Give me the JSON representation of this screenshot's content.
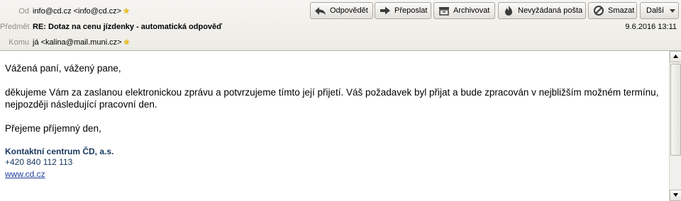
{
  "header": {
    "from_label": "Od",
    "from_value": "info@cd.cz <info@cd.cz>",
    "subject_label": "Předmět",
    "subject_value": "RE: Dotaz na cenu jízdenky - automatická odpověď",
    "to_label": "Komu",
    "to_value": "já <kalina@mail.muni.cz>",
    "date": "9.6.2016 13:11"
  },
  "toolbar": {
    "reply_label": "Odpovědět",
    "forward_label": "Přeposlat",
    "archive_label": "Archivovat",
    "junk_label": "Nevyžádaná pošta",
    "delete_label": "Smazat",
    "more_label": "Další"
  },
  "body": {
    "greeting": "Vážená paní, vážený pane,",
    "paragraph1": "děkujeme Vám za zaslanou elektronickou zprávu a potvrzujeme tímto její přijetí. Váš požadavek byl přijat a bude zpracován v nejbližším možném termínu, nejpozději následující pracovní den.",
    "closing": "Přejeme příjemný den,",
    "signature_name": "Kontaktní centrum ČD, a.s.",
    "signature_phone": "+420 840 112 113",
    "signature_link": "www.cd.cz"
  },
  "icons": {
    "star": "star-icon",
    "reply": "reply-arrow-icon",
    "forward": "forward-arrow-icon",
    "archive": "archive-box-icon",
    "junk": "junk-flame-icon",
    "delete": "delete-circle-icon",
    "more": "dropdown-triangle-icon"
  },
  "colors": {
    "signature": "#17375e",
    "link": "#1f3f9e",
    "star": "#f2c21b"
  }
}
